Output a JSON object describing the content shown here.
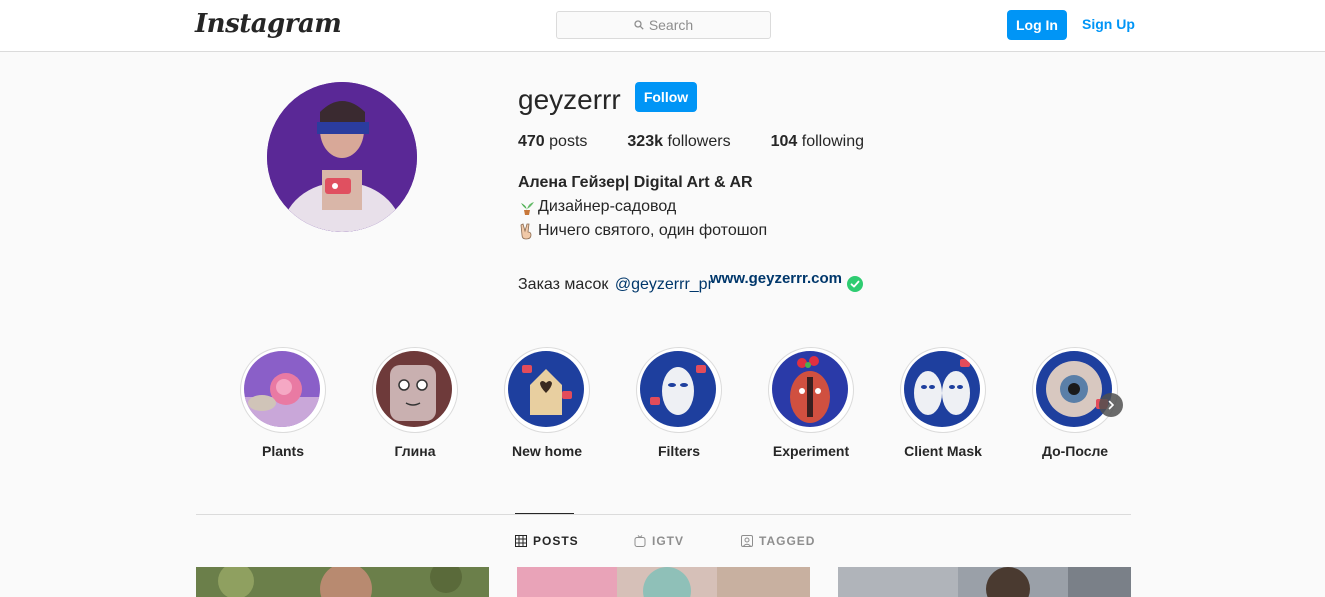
{
  "nav": {
    "logo": "Instagram",
    "search_placeholder": "Search",
    "login_label": "Log In",
    "signup_label": "Sign Up"
  },
  "profile": {
    "username": "geyzerrr",
    "follow_label": "Follow",
    "stats": {
      "posts_count": "470",
      "posts_label": "posts",
      "followers_count": "323k",
      "followers_label": "followers",
      "following_count": "104",
      "following_label": "following"
    },
    "bio": {
      "name": "Алена Гейзер| Digital Art & AR",
      "line1": "Дизайнер-садовод",
      "line2": "Ничего святого, один фотошоп",
      "line3_prefix": "Заказ масок ",
      "line3_mention": "@geyzerrr_pr",
      "website": "www.geyzerrr.com"
    }
  },
  "highlights": [
    {
      "label": "Plants",
      "icon": "rose-icon"
    },
    {
      "label": "Глина",
      "icon": "clay-face-icon"
    },
    {
      "label": "New home",
      "icon": "birdhouse-icon"
    },
    {
      "label": "Filters",
      "icon": "mask-icon"
    },
    {
      "label": "Experiment",
      "icon": "face-icon"
    },
    {
      "label": "Client Mask",
      "icon": "masks-icon"
    },
    {
      "label": "До-После",
      "icon": "eye-icon"
    }
  ],
  "tabs": [
    {
      "label": "POSTS",
      "icon": "grid-icon",
      "active": true
    },
    {
      "label": "IGTV",
      "icon": "igtv-icon",
      "active": false
    },
    {
      "label": "TAGGED",
      "icon": "tagged-icon",
      "active": false
    }
  ],
  "colors": {
    "accent": "#0095f6",
    "link": "#00376b",
    "verified": "#2ecc71"
  }
}
